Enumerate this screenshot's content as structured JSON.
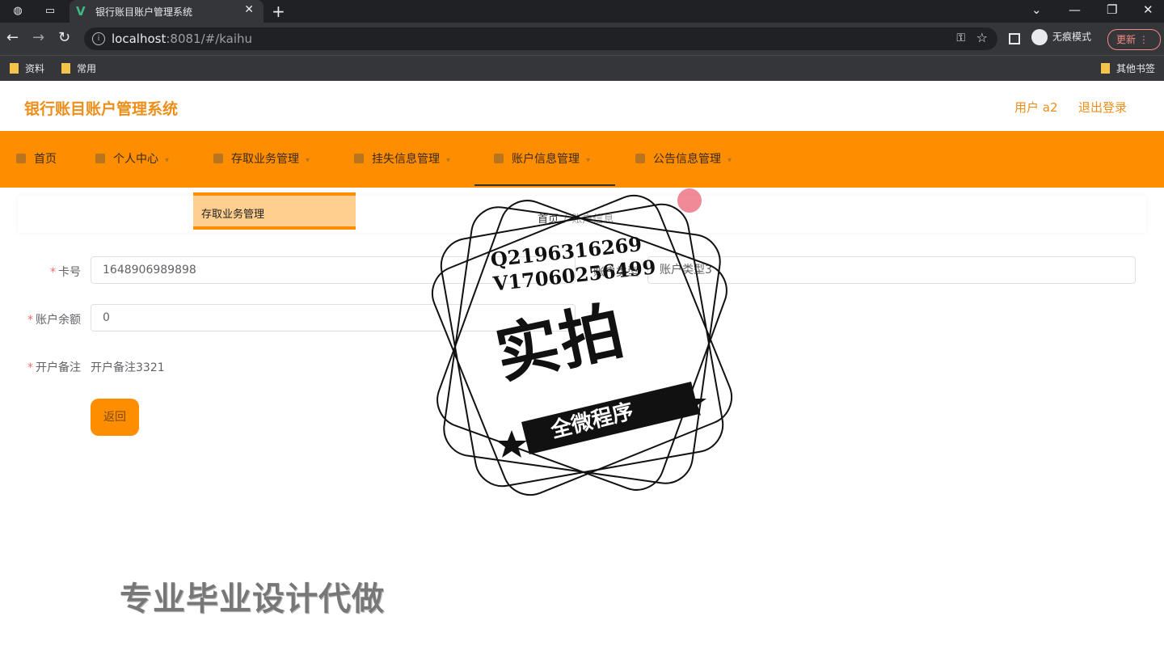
{
  "browser": {
    "tab_title": "银行账目账户管理系统",
    "url_host": "localhost",
    "url_rest": ":8081/#/kaihu",
    "incognito_label": "无痕模式",
    "update_label": "更新",
    "bookmarks": [
      "资料",
      "常用"
    ],
    "other_bookmarks": "其他书签"
  },
  "app": {
    "title": "银行账目账户管理系统",
    "user_label": "用户 a2",
    "logout_label": "退出登录"
  },
  "nav": {
    "items": [
      {
        "label": "首页",
        "icon": "home-icon"
      },
      {
        "label": "个人中心",
        "icon": "user-icon"
      },
      {
        "label": "存取业务管理",
        "icon": "deposit-icon"
      },
      {
        "label": "挂失信息管理",
        "icon": "report-loss-icon"
      },
      {
        "label": "账户信息管理",
        "icon": "account-icon"
      },
      {
        "label": "公告信息管理",
        "icon": "notice-icon"
      }
    ],
    "active": "账户信息管理",
    "submenu_item": "存取业务管理"
  },
  "breadcrumb": {
    "home": "首页",
    "current": "账户信息"
  },
  "form": {
    "card_label": "卡号",
    "card_value": "1648906989898",
    "type_label": "账户类型",
    "type_value": "账户类型3",
    "balance_label": "账户余额",
    "balance_value": "0",
    "remark_label": "开户备注",
    "remark_value": "开户备注3321",
    "back_label": "返回"
  },
  "overlay": {
    "stamp_line1": "Q2196316269",
    "stamp_line2": "V17060256499",
    "stamp_big": "实拍",
    "stamp_band": "全微程序",
    "watermark": "专业毕业设计代做"
  },
  "colors": {
    "accent": "#ff8d00",
    "title": "#ec8e1a"
  }
}
